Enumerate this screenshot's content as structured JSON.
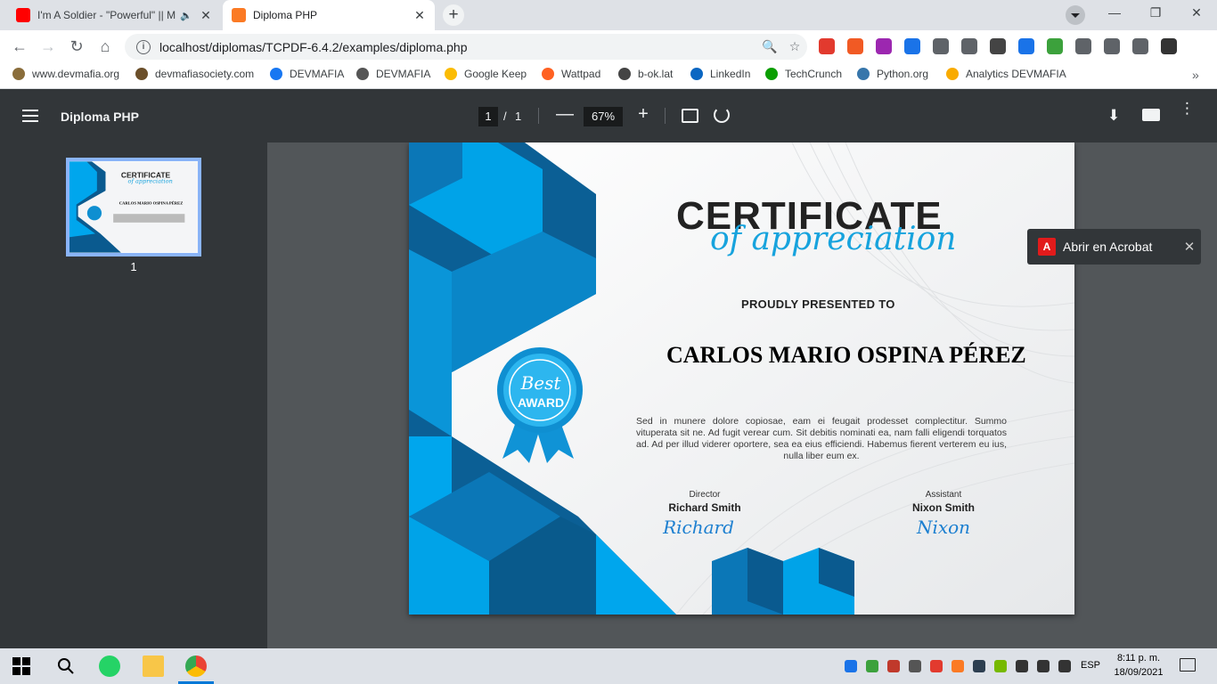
{
  "tabs": [
    {
      "title": "I'm A Soldier - \"Powerful\" || M",
      "close": "✕",
      "favicon_color": "#ff0000",
      "audio_icon": "🔈"
    },
    {
      "title": "Diploma PHP",
      "close": "✕",
      "favicon_color": "#fb7a24"
    }
  ],
  "new_tab_label": "+",
  "window_controls": {
    "minimize": "—",
    "maximize": "❐",
    "close": "✕"
  },
  "nav": {
    "back": "←",
    "forward": "→",
    "reload": "↻",
    "home": "⌂"
  },
  "omnibox": {
    "info": "i",
    "url": "localhost/diplomas/TCPDF-6.4.2/examples/diploma.php",
    "zoom_icon": "🔍",
    "star_icon": "☆"
  },
  "extensions": [
    {
      "name": "abp-icon",
      "color": "#e23a2e"
    },
    {
      "name": "vpn-icon",
      "color": "#f15a24"
    },
    {
      "name": "colorpicker-icon",
      "color": "#9c27b0"
    },
    {
      "name": "tv-icon",
      "color": "#1a73e8"
    },
    {
      "name": "screenshot-icon",
      "color": "#5f6368"
    },
    {
      "name": "camera-icon",
      "color": "#5f6368"
    },
    {
      "name": "download-ext-icon",
      "color": "#444"
    },
    {
      "name": "new-ext-icon",
      "color": "#1a73e8"
    },
    {
      "name": "globe-ext-icon",
      "color": "#3ca13c"
    },
    {
      "name": "timer-icon",
      "color": "#5f6368"
    },
    {
      "name": "puzzle-icon",
      "color": "#5f6368"
    },
    {
      "name": "media-icon",
      "color": "#5f6368"
    },
    {
      "name": "avatar-icon",
      "color": "#333"
    }
  ],
  "bookmarks": [
    {
      "label": "www.devmafia.org",
      "color": "#8a6d3b"
    },
    {
      "label": "devmafiasociety.com",
      "color": "#6b4f2a"
    },
    {
      "label": "DEVMAFIA",
      "color": "#1877f2"
    },
    {
      "label": "DEVMAFIA",
      "color": "#555"
    },
    {
      "label": "Google Keep",
      "color": "#fbbc04"
    },
    {
      "label": "Wattpad",
      "color": "#ff6122"
    },
    {
      "label": "b-ok.lat",
      "color": "#444"
    },
    {
      "label": "LinkedIn",
      "color": "#0a66c2"
    },
    {
      "label": "TechCrunch",
      "color": "#0a9e01"
    },
    {
      "label": "Python.org",
      "color": "#3776ab"
    },
    {
      "label": "Analytics DEVMAFIA",
      "color": "#f9ab00"
    }
  ],
  "bookmarks_more": "»",
  "pdf": {
    "title": "Diploma PHP",
    "page": "1",
    "page_sep": "/",
    "total": "1",
    "zoom_out": "—",
    "zoom": "67%",
    "zoom_in": "+",
    "download": "⬇",
    "more": "⋮",
    "thumb_label": "1"
  },
  "certificate": {
    "title": "CERTIFICATE",
    "subtitle": "of appreciation",
    "presented": "PROUDLY PRESENTED TO",
    "name": "CARLOS MARIO OSPINA PÉREZ",
    "body": "Sed in munere dolore copiosae, eam ei feugait prodesset complectitur. Summo vituperata sit ne. Ad fugit verear cum. Sit debitis nominati ea, nam falli eligendi torquatos ad. Ad per illud viderer oportere, sea ea eius efficiendi. Habemus fierent verterem eu ius, nulla liber eum ex.",
    "badge_script": "Best",
    "badge_main": "AWARD",
    "sig1_role": "Director",
    "sig1_name": "Richard Smith",
    "sig1_sign": "Richard",
    "sig2_role": "Assistant",
    "sig2_name": "Nixon Smith",
    "sig2_sign": "Nixon",
    "accent": "#17a3dd"
  },
  "acrobat": {
    "label": "Abrir en Acrobat",
    "icon": "A",
    "close": "✕"
  },
  "taskbar": {
    "time": "8:11 p. m.",
    "date": "18/09/2021",
    "lang": "ESP"
  }
}
